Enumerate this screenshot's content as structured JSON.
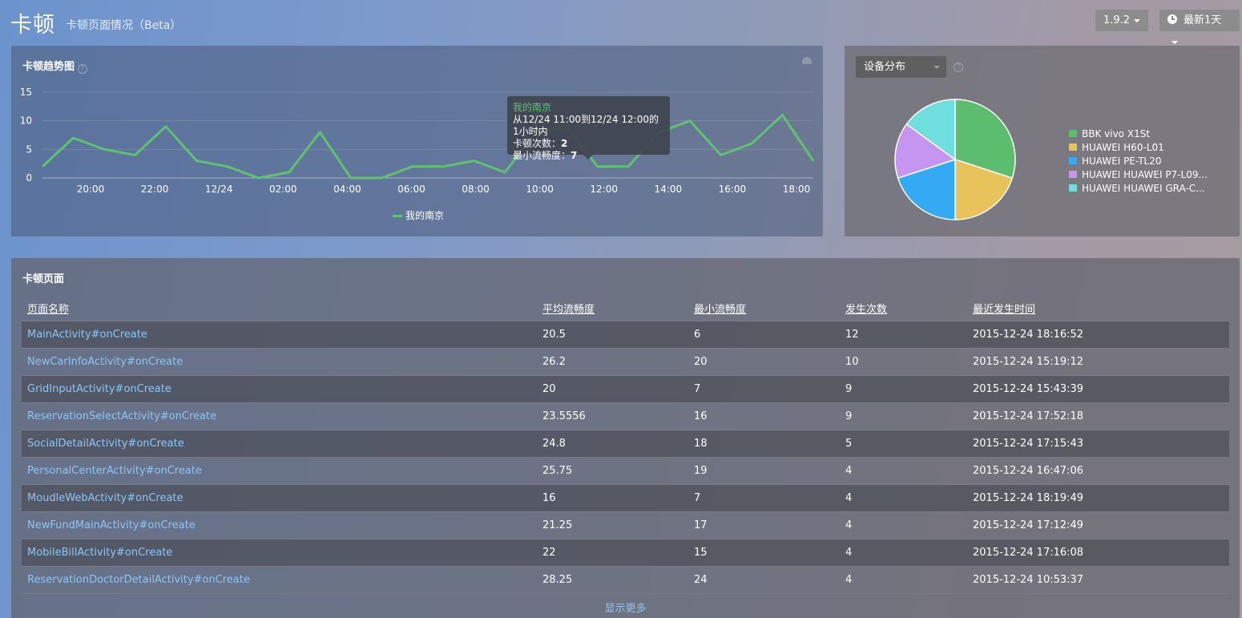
{
  "header": {
    "title": "卡顿",
    "subtitle": "卡顿页面情况（Beta）",
    "version_label": "1.9.2",
    "time_range_label": "最新1天"
  },
  "trend": {
    "title": "卡顿趋势图",
    "help": "?",
    "legend_label": "我的南京",
    "tooltip": {
      "series": "我的南京",
      "range": "从12/24 11:00到12/24 12:00的1小时内",
      "count_label": "卡顿次数：",
      "count_value": "2",
      "min_label": "最小流畅度：",
      "min_value": "7"
    }
  },
  "chart_data": [
    {
      "type": "line",
      "title": "卡顿趋势图",
      "xlabel": "",
      "ylabel": "",
      "ylim": [
        0,
        15
      ],
      "yticks": [
        0,
        5,
        10,
        15
      ],
      "x_tick_labels": [
        "20:00",
        "22:00",
        "12/24",
        "02:00",
        "04:00",
        "06:00",
        "08:00",
        "10:00",
        "12:00",
        "14:00",
        "16:00",
        "18:00"
      ],
      "grid": true,
      "color": "#5ec26f",
      "series": [
        {
          "name": "我的南京",
          "values": [
            2,
            7,
            5,
            4,
            9,
            3,
            2,
            0,
            1,
            8,
            0,
            0,
            2,
            2,
            3,
            1,
            8,
            9,
            2,
            2,
            8,
            10,
            4,
            6,
            11,
            3
          ]
        }
      ],
      "highlight_index": 17
    },
    {
      "type": "pie",
      "title": "设备分布",
      "legend_position": "right",
      "labels": [
        "BBK vivo X1St",
        "HUAWEI H60-L01",
        "HUAWEI PE-TL20",
        "HUAWEI HUAWEI P7-L09...",
        "HUAWEI HUAWEI GRA-C..."
      ],
      "values": [
        30,
        20,
        20,
        15,
        15
      ],
      "colors": [
        "#5cbd6f",
        "#e8c35c",
        "#35aaf4",
        "#c595f0",
        "#6fdede"
      ]
    }
  ],
  "device": {
    "select_label": "设备分布",
    "help": "?"
  },
  "pages": {
    "title": "卡顿页面",
    "columns": [
      "页面名称",
      "平均流畅度",
      "最小流畅度",
      "发生次数",
      "最近发生时间"
    ],
    "rows": [
      [
        "MainActivity#onCreate",
        "20.5",
        "6",
        "12",
        "2015-12-24 18:16:52"
      ],
      [
        "NewCarInfoActivity#onCreate",
        "26.2",
        "20",
        "10",
        "2015-12-24 15:19:12"
      ],
      [
        "GridInputActivity#onCreate",
        "20",
        "7",
        "9",
        "2015-12-24 15:43:39"
      ],
      [
        "ReservationSelectActivity#onCreate",
        "23.5556",
        "16",
        "9",
        "2015-12-24 17:52:18"
      ],
      [
        "SocialDetailActivity#onCreate",
        "24.8",
        "18",
        "5",
        "2015-12-24 17:15:43"
      ],
      [
        "PersonalCenterActivity#onCreate",
        "25.75",
        "19",
        "4",
        "2015-12-24 16:47:06"
      ],
      [
        "MoudleWebActivity#onCreate",
        "16",
        "7",
        "4",
        "2015-12-24 18:19:49"
      ],
      [
        "NewFundMainActivity#onCreate",
        "21.25",
        "17",
        "4",
        "2015-12-24 17:12:49"
      ],
      [
        "MobileBillActivity#onCreate",
        "22",
        "15",
        "4",
        "2015-12-24 17:16:08"
      ],
      [
        "ReservationDoctorDetailActivity#onCreate",
        "28.25",
        "24",
        "4",
        "2015-12-24 10:53:37"
      ]
    ],
    "show_more": "显示更多"
  }
}
